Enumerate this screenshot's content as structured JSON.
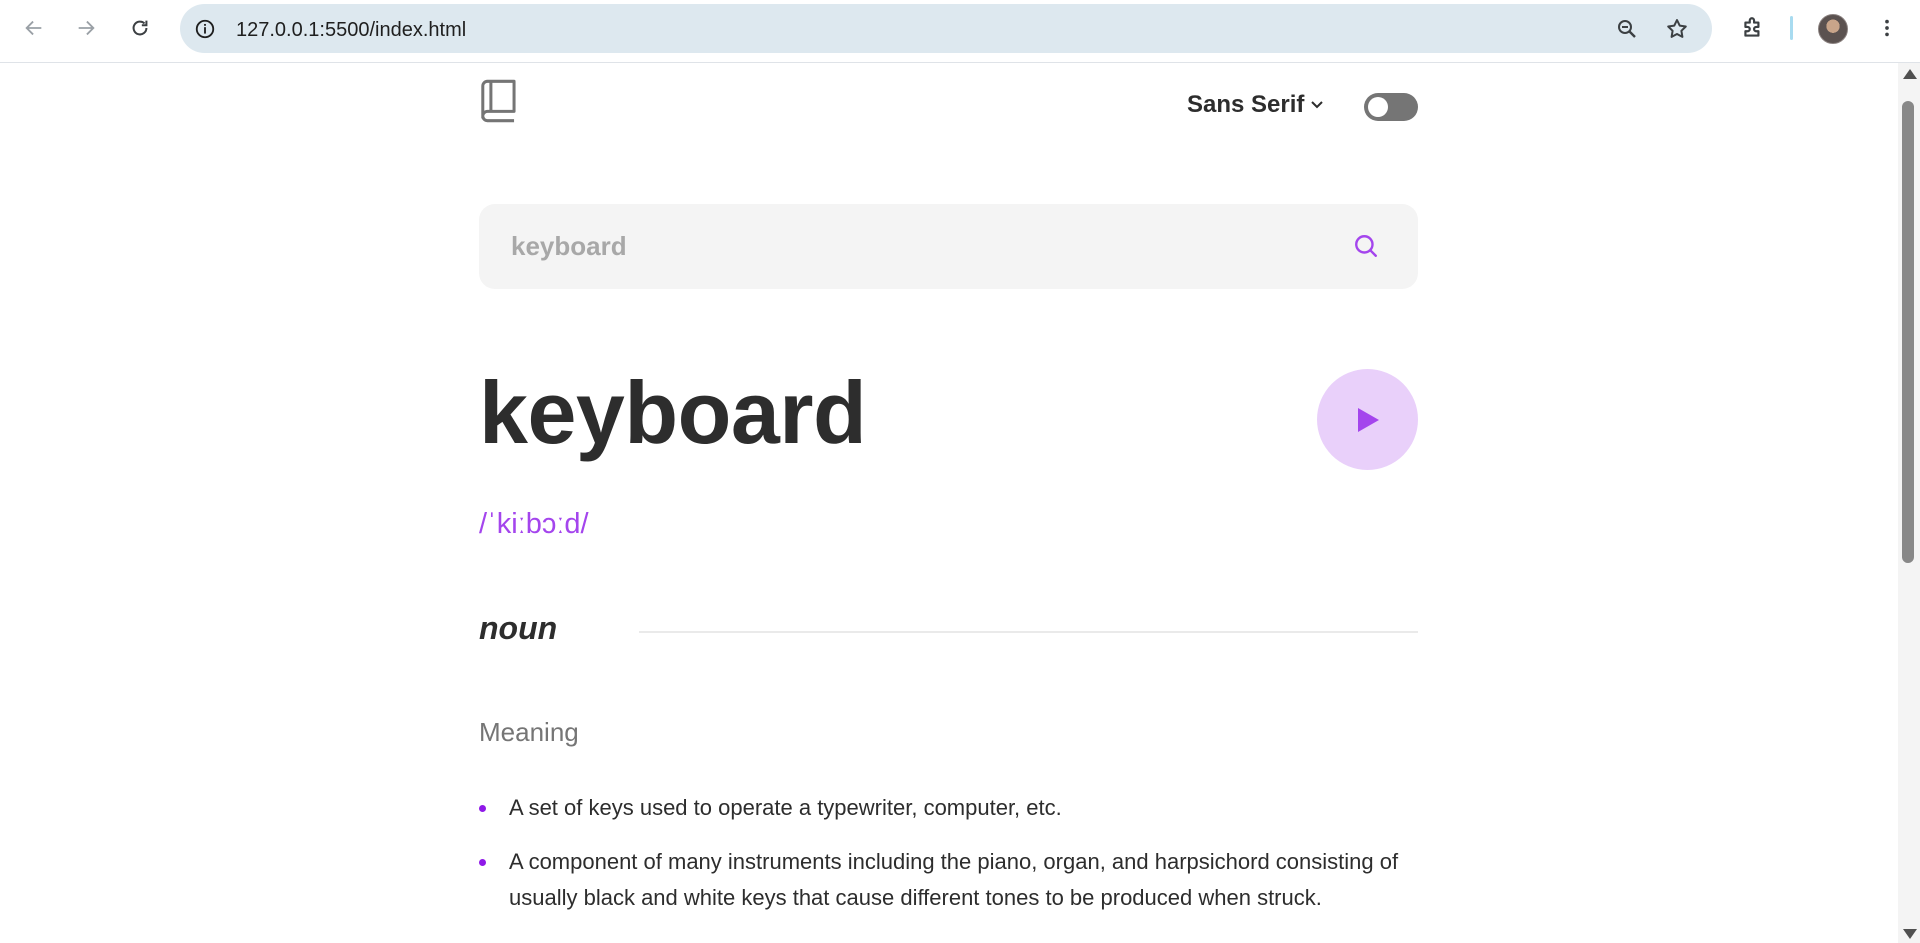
{
  "browser": {
    "url": "127.0.0.1:5500/index.html"
  },
  "header": {
    "font_selected": "Sans Serif",
    "theme_dark": false
  },
  "search": {
    "value": "",
    "placeholder": "keyboard"
  },
  "entry": {
    "word": "keyboard",
    "phonetic": "/ˈkiːbɔːd/",
    "part_of_speech": "noun",
    "meaning_label": "Meaning",
    "definitions": [
      "A set of keys used to operate a typewriter, computer, etc.",
      "A component of many instruments including the piano, organ, and harpsichord consisting of usually black and white keys that cause different tones to be produced when struck."
    ]
  },
  "colors": {
    "accent": "#a445ed",
    "play_bg": "#e9d0fa",
    "text": "#2d2d2d",
    "muted": "#757575",
    "search_bg": "#f4f4f4"
  }
}
